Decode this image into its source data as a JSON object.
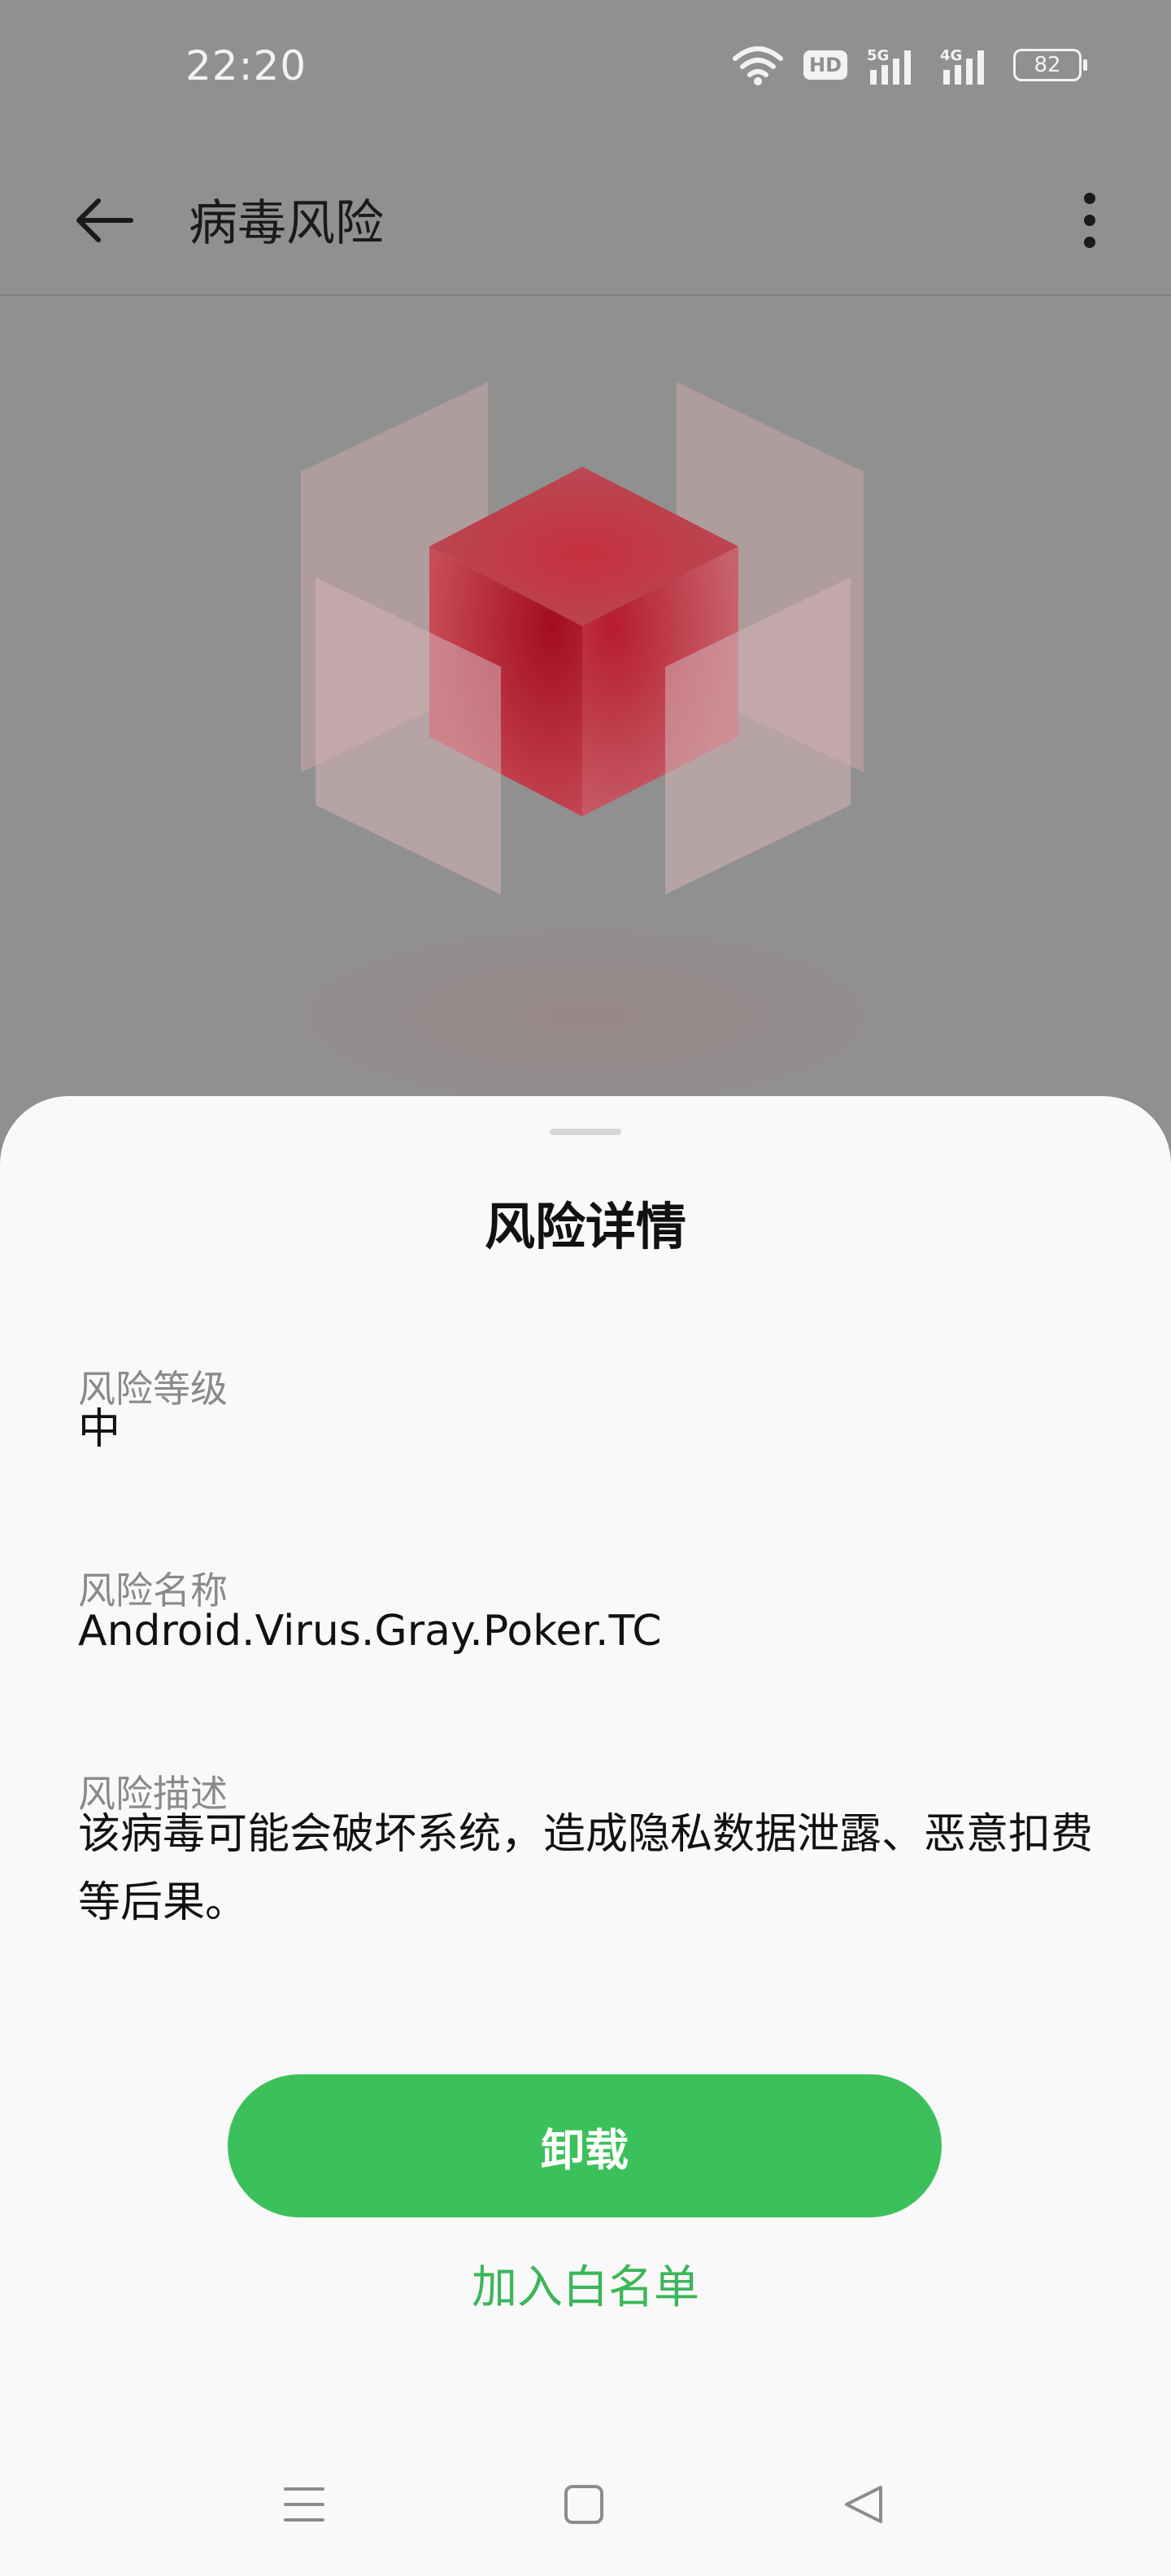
{
  "status_bar": {
    "time": "22:20",
    "hd_label": "HD",
    "battery_level": "82",
    "icons": [
      "wifi-icon",
      "hd-voice-icon",
      "5g-signal-icon",
      "4g-signal-icon",
      "battery-icon"
    ]
  },
  "app_bar": {
    "title": "病毒风险",
    "back_icon": "arrow-left-icon",
    "more_icon": "more-vertical-icon"
  },
  "hero": {
    "icon": "virus-cube-illustration",
    "accent_color": "#c8102e"
  },
  "sheet": {
    "title": "风险详情",
    "fields": [
      {
        "label": "风险等级",
        "value": "中"
      },
      {
        "label": "风险名称",
        "value": "Android.Virus.Gray.Poker.TC"
      },
      {
        "label": "风险描述",
        "value": "该病毒可能会破坏系统，造成隐私数据泄露、恶意扣费等后果。"
      }
    ],
    "primary_action": "卸载",
    "secondary_action": "加入白名单",
    "primary_color": "#3cc05b"
  },
  "nav_bar": {
    "icons": [
      "menu-icon",
      "home-icon",
      "back-triangle-icon"
    ]
  }
}
